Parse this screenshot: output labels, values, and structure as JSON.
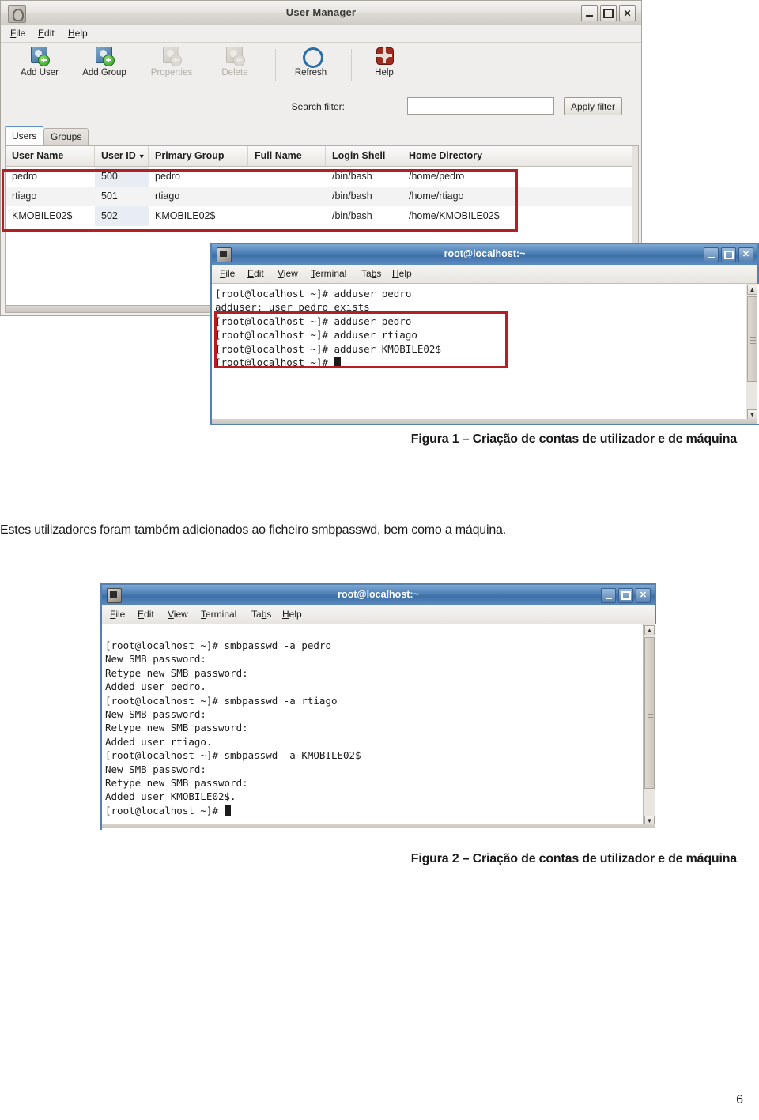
{
  "document": {
    "caption1": "Figura 1 – Criação de contas de utilizador e de máquina",
    "paragraph1": "Estes utilizadores foram também adicionados ao ficheiro smbpasswd, bem como a máquina.",
    "caption2": "Figura 2 – Criação de contas de utilizador e de máquina",
    "page_number": "6"
  },
  "colors": {
    "highlight_red": "#b41f23",
    "titlebar_blue": "#4a7db4",
    "sort_column": "#e7edf3"
  },
  "user_manager": {
    "title": "User Manager",
    "window_icon": "user-manager-icon",
    "window_buttons": [
      {
        "name": "minimize",
        "glyph": ""
      },
      {
        "name": "maximize",
        "glyph": ""
      },
      {
        "name": "close",
        "glyph": "✕"
      }
    ],
    "menus": [
      {
        "label": "File",
        "accel": "F"
      },
      {
        "label": "Edit",
        "accel": "E"
      },
      {
        "label": "Help",
        "accel": "H"
      }
    ],
    "toolbar": [
      {
        "label": "Add User",
        "icon": "add-user-icon",
        "disabled": false
      },
      {
        "label": "Add Group",
        "icon": "add-group-icon",
        "disabled": false
      },
      {
        "label": "Properties",
        "icon": "properties-icon",
        "disabled": true
      },
      {
        "label": "Delete",
        "icon": "delete-icon",
        "disabled": true
      },
      {
        "label": "Refresh",
        "icon": "refresh-icon",
        "disabled": false
      },
      {
        "label": "Help",
        "icon": "help-icon",
        "disabled": false
      }
    ],
    "filter": {
      "label": "Search filter:",
      "value": "",
      "placeholder": "",
      "apply_button": "Apply filter"
    },
    "tabs": [
      {
        "label": "Users",
        "active": true
      },
      {
        "label": "Groups",
        "active": false
      }
    ],
    "table": {
      "columns": [
        "User Name",
        "User ID",
        "Primary Group",
        "Full Name",
        "Login Shell",
        "Home Directory"
      ],
      "sort_column": "User ID",
      "sort_direction": "descending",
      "sort_arrow": "▼",
      "rows": [
        {
          "user_name": "pedro",
          "user_id": "500",
          "primary_group": "pedro",
          "full_name": "",
          "login_shell": "/bin/bash",
          "home_directory": "/home/pedro"
        },
        {
          "user_name": "rtiago",
          "user_id": "501",
          "primary_group": "rtiago",
          "full_name": "",
          "login_shell": "/bin/bash",
          "home_directory": "/home/rtiago"
        },
        {
          "user_name": "KMOBILE02$",
          "user_id": "502",
          "primary_group": "KMOBILE02$",
          "full_name": "",
          "login_shell": "/bin/bash",
          "home_directory": "/home/KMOBILE02$"
        }
      ]
    }
  },
  "terminal1": {
    "title": "root@localhost:~",
    "menus": [
      {
        "label": "File",
        "accel": "F"
      },
      {
        "label": "Edit",
        "accel": "E"
      },
      {
        "label": "View",
        "accel": "V"
      },
      {
        "label": "Terminal",
        "accel": "T"
      },
      {
        "label": "Tabs",
        "accel": "b"
      },
      {
        "label": "Help",
        "accel": "H"
      }
    ],
    "lines": [
      "[root@localhost ~]# adduser pedro",
      "adduser: user pedro exists",
      "[root@localhost ~]# adduser pedro",
      "[root@localhost ~]# adduser rtiago",
      "[root@localhost ~]# adduser KMOBILE02$",
      "[root@localhost ~]# "
    ],
    "cursor_line_index": 5,
    "highlight_from_line": 2,
    "highlight_to_line": 5
  },
  "terminal2": {
    "title": "root@localhost:~",
    "menus": [
      {
        "label": "File",
        "accel": "F"
      },
      {
        "label": "Edit",
        "accel": "E"
      },
      {
        "label": "View",
        "accel": "V"
      },
      {
        "label": "Terminal",
        "accel": "T"
      },
      {
        "label": "Tabs",
        "accel": "b"
      },
      {
        "label": "Help",
        "accel": "H"
      }
    ],
    "lines": [
      "[root@localhost ~]# smbpasswd -a pedro",
      "New SMB password:",
      "Retype new SMB password:",
      "Added user pedro.",
      "[root@localhost ~]# smbpasswd -a rtiago",
      "New SMB password:",
      "Retype new SMB password:",
      "Added user rtiago.",
      "[root@localhost ~]# smbpasswd -a KMOBILE02$",
      "New SMB password:",
      "Retype new SMB password:",
      "Added user KMOBILE02$.",
      "[root@localhost ~]# "
    ],
    "cursor_line_index": 12
  }
}
